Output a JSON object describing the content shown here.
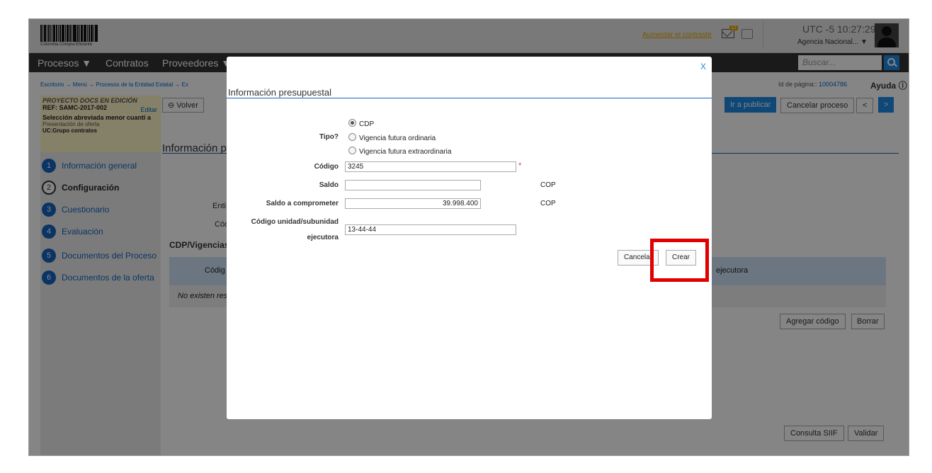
{
  "header": {
    "logo_text": "Colombia Compra Eficiente",
    "contrast_link": "Aumentar el contraste",
    "mail_badge": "12",
    "time": "UTC -5 10:27:29",
    "agency": "Agencia Nacional... ▼"
  },
  "nav": {
    "items": [
      "Procesos ▼",
      "Contratos",
      "Proveedores ▼"
    ],
    "search_placeholder": "Buscar..."
  },
  "page": {
    "breadcrumb": "Escritorio → Menú → Procesos de la Entidad Estatal → Ex",
    "page_id_label": "Id de página:: ",
    "page_id": "10004786",
    "help": "Ayuda ⓘ"
  },
  "sidebar": {
    "project_line1": "PROYECTO DOCS EN EDICIÓN",
    "project_ref": "REF: SAMC-2017-002",
    "edit": "Editar",
    "modality": "Selección abreviada menor cuantí a",
    "phase": "Presentación de oferta",
    "unit": "UC:Grupo contratos",
    "steps": [
      {
        "num": "1",
        "label": "Información general"
      },
      {
        "num": "2",
        "label": "Configuración"
      },
      {
        "num": "3",
        "label": "Cuestionario"
      },
      {
        "num": "4",
        "label": "Evaluación"
      },
      {
        "num": "5",
        "label": "Documentos del Proceso"
      },
      {
        "num": "6",
        "label": "Documentos de la oferta"
      }
    ]
  },
  "toolbar": {
    "back": "Volver",
    "publish": "Ir a publicar",
    "cancel_process": "Cancelar proceso",
    "prev": "<",
    "next": ">"
  },
  "main": {
    "section_title": "Información pr",
    "entity_label": "Enti",
    "code_label": "Cód",
    "cdp_heading": "CDP/Vigencias I",
    "col_codigo": "Códig",
    "col_ejecutora": "ejecutora",
    "no_results": "No existen res",
    "add_code": "Agregar código",
    "delete": "Borrar",
    "siif": "Consulta SIIF",
    "validate": "Validar"
  },
  "modal": {
    "close": "X",
    "title": "Información presupuestal",
    "tipo_label": "Tipo?",
    "tipo_options": [
      "CDP",
      "Vigencia futura ordinaria",
      "Vigencia futura extraordinaria"
    ],
    "tipo_selected": "CDP",
    "codigo_label": "Código",
    "codigo_value": "3245",
    "saldo_label": "Saldo",
    "saldo_value": "",
    "saldo_currency": "COP",
    "comprometer_label": "Saldo a comprometer",
    "comprometer_value": "39.998.400",
    "comprometer_currency": "COP",
    "unidad_label_1": "Código unidad/subunidad",
    "unidad_label_2": "ejecutora",
    "unidad_value": "13-44-44",
    "cancel_button": "Cancelar",
    "create_button": "Crear"
  },
  "colors": {
    "accent_blue": "#1e88e5",
    "highlight_red": "#e00000",
    "nav_bg": "#333333"
  }
}
